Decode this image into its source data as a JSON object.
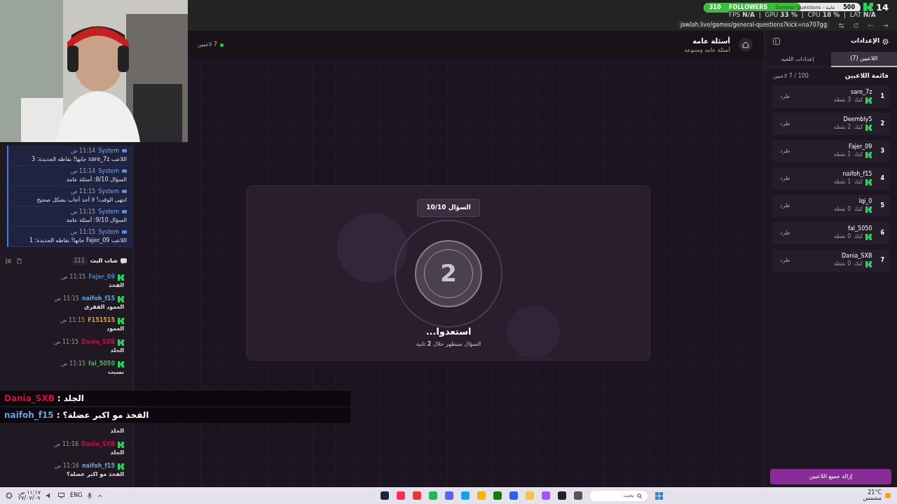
{
  "browser": {
    "url": "jawlah.live/games/general-questions?kick=na707gg"
  },
  "overlay": {
    "followers": {
      "current": "310",
      "label": "FOLLOWERS",
      "ticker": "General Questions - عامة",
      "goal": "500",
      "level": 0.62
    },
    "count": "14",
    "stats": "FPS **N/A**  |  GPU **33 %**  |  CPU **18 %**  |  LAT **N/A**",
    "chat": [
      {
        "user": "Dania_SXB",
        "color": "#d0143c",
        "separator": ":",
        "text": "الجلد"
      },
      {
        "user": "naifoh_f15",
        "color": "#6aa6dc",
        "separator": ":",
        "text": "الفخذ مو اكبر عضلة؟"
      }
    ]
  },
  "system_log": [
    {
      "sender": "System",
      "time": "11:14 ص",
      "text": "اللاعب sare_7z جابها! نقاطه الجديدة: 3"
    },
    {
      "sender": "System",
      "time": "11:14 ص",
      "text": "السؤال 8/10: أسئلة عامة"
    },
    {
      "sender": "System",
      "time": "11:15 ص",
      "text": "انتهى الوقت! لا أحد أجاب بشكل صحيح"
    },
    {
      "sender": "System",
      "time": "11:15 ص",
      "text": "السؤال 9/10: أسئلة عامة"
    },
    {
      "sender": "System",
      "time": "11:15 ص",
      "text": "اللاعب Fajer_09 جابها! نقاطه الجديدة: 1"
    }
  ],
  "stream_chat": {
    "title": "شات البث",
    "count": "111",
    "messages": [
      {
        "user": "Fajer_09",
        "color": "#3b82c4",
        "time": "11:15 ص",
        "text": "الفخذ"
      },
      {
        "user": "naifoh_f15",
        "color": "#6aa6dc",
        "time": "11:15 ص",
        "text": "العمود الفقري"
      },
      {
        "user": "F151515",
        "color": "#e0a020",
        "time": "11:15 ص",
        "text": "العمود"
      },
      {
        "user": "Dania_SXB",
        "color": "#c0124a",
        "time": "11:15 ص",
        "text": "الجلد"
      },
      {
        "user": "fal_5050",
        "color": "#4caf50",
        "time": "11:15 ص",
        "text": "نسيت"
      },
      {
        "text": "الجلد"
      },
      {
        "user": "Dania_SXB",
        "color": "#c0124a",
        "time": "11:16 ص",
        "text": "الجلد"
      },
      {
        "user": "naifoh_f15",
        "color": "#6aa6dc",
        "time": "11:16 ص",
        "text": "الفخذ مو اكبر عضلة؟"
      }
    ]
  },
  "game": {
    "title": "أسئلة عامة",
    "subtitle": "أسئلة عامة ومتنوعة",
    "players_online": "7 لاعبين",
    "badge": "السؤال 10/10",
    "countdown": "2",
    "heading": "استعدوا...",
    "note": "السؤال سيظهر خلال **2** ثانية"
  },
  "settings": {
    "title": "الإعدادات",
    "tabs": [
      {
        "label": "اللاعبين (7)",
        "selected": true
      },
      {
        "label": "إعدادات اللعبة",
        "selected": false
      }
    ],
    "list_title": "قائمة اللاعبين",
    "capacity": "100 / 7 لاعبين",
    "players": [
      {
        "rank": "1",
        "name": "sare_7z",
        "platform": "كيك",
        "points": "3 نقطة",
        "action": "طرد"
      },
      {
        "rank": "2",
        "name": "Deembly5",
        "platform": "كيك",
        "points": "2 نقطة",
        "action": "طرد"
      },
      {
        "rank": "3",
        "name": "Fajer_09",
        "platform": "كيك",
        "points": "1 نقطة",
        "action": "طرد"
      },
      {
        "rank": "4",
        "name": "naifoh_f15",
        "platform": "كيك",
        "points": "1 نقطة",
        "action": "طرد"
      },
      {
        "rank": "5",
        "name": "lqi_0",
        "platform": "كيك",
        "points": "0 نقطة",
        "action": "طرد"
      },
      {
        "rank": "6",
        "name": "fal_5050",
        "platform": "كيك",
        "points": "0 نقطة",
        "action": "طرد"
      },
      {
        "rank": "7",
        "name": "Dania_SXB",
        "platform": "كيك",
        "points": "0 نقطة",
        "action": "طرد"
      }
    ],
    "remove_all": "إزالة جميع اللاعبين"
  },
  "taskbar": {
    "time": "١١:١٧ ص",
    "date": "٢٧/٠٧/٠٩",
    "language": "ENG",
    "search": "بحث",
    "temperature": "21°C",
    "weather": "مشمس"
  }
}
